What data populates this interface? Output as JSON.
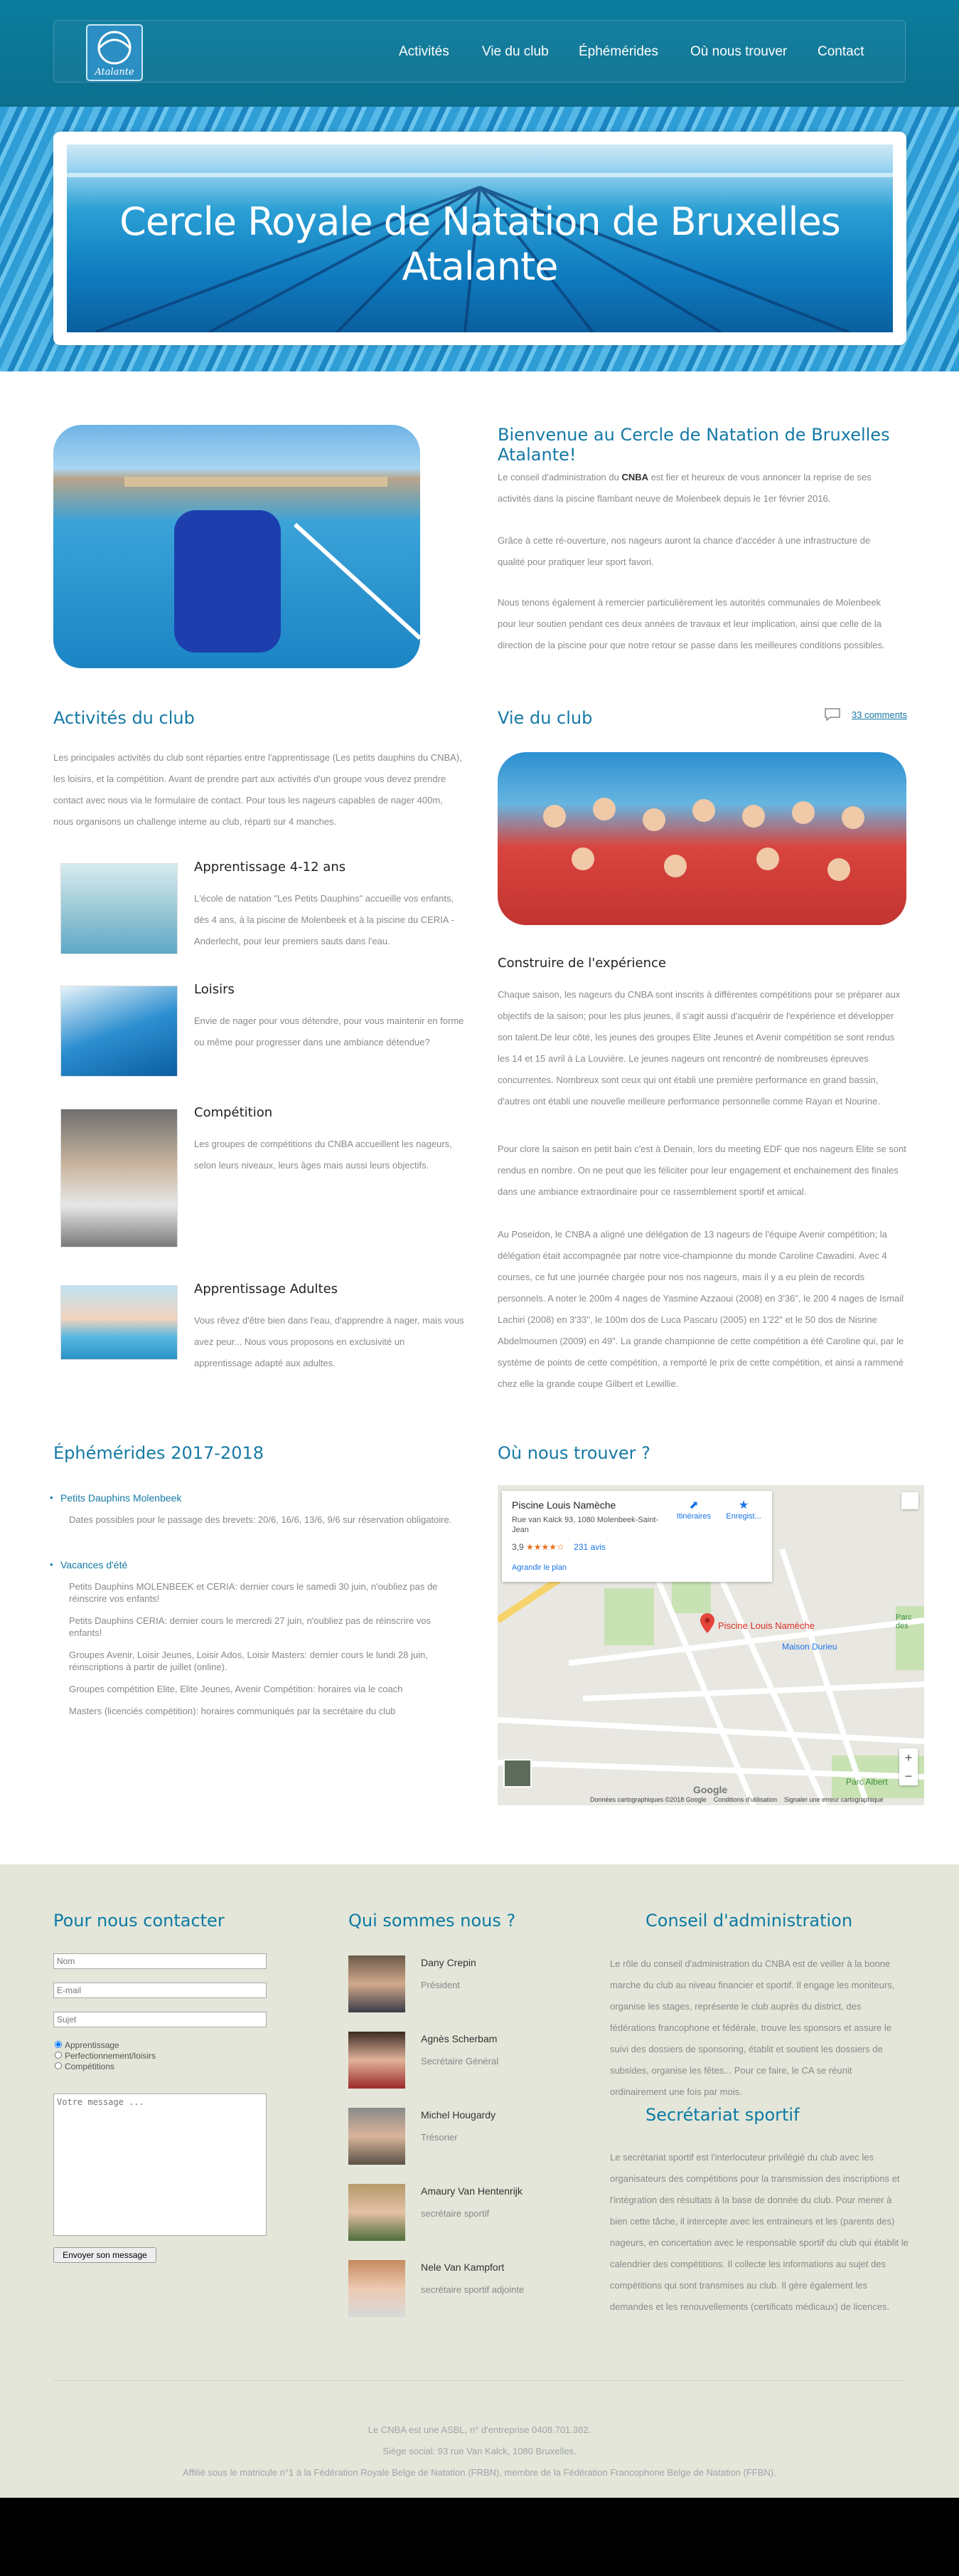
{
  "nav": {
    "logo_text": "Atalante",
    "items": [
      "Activités",
      "Vie du club",
      "Éphémérides",
      "Où nous trouver",
      "Contact"
    ]
  },
  "hero": {
    "title": "Cercle Royale de Natation de Bruxelles Atalante"
  },
  "welcome": {
    "title": "Bienvenue au Cercle de Natation de Bruxelles Atalante!",
    "p1_pre": "Le conseil d'administration du ",
    "p1_bold": "CNBA",
    "p1_post": " est fier et heureux de vous annoncer la reprise de ses activités dans la piscine flambant neuve de Molenbeek depuis le 1er février 2016.",
    "p2": "Grâce à cette ré-ouverture, nos nageurs auront la chance d'accéder à une infrastructure de qualité pour pratiquer leur sport favori.",
    "p3": "Nous tenons également à remercier particulièrement les autorités communales de Molenbeek pour leur soutien pendant ces deux années de travaux et leur implication, ainsi que celle de la direction de la piscine pour que notre retour se passe dans les meilleures conditions possibles."
  },
  "activities": {
    "title": "Activités du club",
    "intro": "Les principales activités du club sont réparties entre l'apprentissage (Les petits dauphins du CNBA), les loisirs, et la compétition. Avant de prendre part aux activités d'un groupe vous devez prendre contact avec nous via le formulaire de contact. Pour tous les nageurs capables de nager 400m, nous organisons un challenge interne au club, réparti sur 4 manches.",
    "items": [
      {
        "title": "Apprentissage 4-12 ans",
        "text": "L'école de natation \"Les Petits Dauphins\" accueille vos enfants, dès 4 ans, à la piscine de Molenbeek et à la piscine du CERIA - Anderlecht, pour leur premiers sauts dans l'eau."
      },
      {
        "title": "Loisirs",
        "text": "Envie de nager pour vous détendre, pour vous maintenir en forme ou même pour progresser dans une ambiance détendue?"
      },
      {
        "title": "Compétition",
        "text": "Les groupes de compétitions du CNBA accueillent les nageurs, selon leurs niveaux, leurs âges mais aussi leurs objectifs."
      },
      {
        "title": "Apprentissage Adultes",
        "text": "Vous rêvez d'être bien dans l'eau, d'apprendre à nager, mais vous avez peur... Nous vous proposons en exclusivité un apprentissage adapté aux adultes."
      }
    ]
  },
  "clublife": {
    "title": "Vie du club",
    "comments": "33 comments",
    "subtitle": "Construire de l'expérience",
    "p1": "Chaque saison, les nageurs du CNBA sont inscrits à différentes compétitions pour se préparer aux objectifs de la saison; pour les plus jeunes, il s'agit aussi d'acquérir de l'expérience et développer son talent.De leur côté, les jeunes des groupes Elite Jeunes et Avenir compétition se sont rendus les 14 et 15 avril à La Louvière. Le jeunes nageurs ont rencontré de nombreuses épreuves concurrentes. Nombreux sont ceux qui ont établi une première performance en grand bassin, d'autres ont établi une nouvelle meilleure performance personnelle comme Rayan et Nourine.",
    "p2": "Pour clore la saison en petit bain c'est à Denain, lors du meeting EDF que nos nageurs Elite se sont rendus en nombre. On ne peut que les féliciter pour leur engagement et enchainement des finales dans une ambiance extraordinaire pour ce rassemblement sportif et amical.",
    "p3": "Au Poseidon, le CNBA a aligné une délégation de 13 nageurs de l'équipe Avenir compétition; la délégation était accompagnée par notre vice-championne du monde Caroline Cawadini. Avec 4 courses, ce fut une journée chargée pour nos nos nageurs, mais il y a eu plein de records personnels. A noter le 200m 4 nages de Yasmine Azzaoui (2008) en 3'36\", le 200 4 nages de Ismail Lachiri (2008) en 3'33\", le 100m dos de Luca Pascaru (2005) en 1'22\" et le 50 dos de Nisrine Abdelmoumen (2009) en 49\". La grande championne de cette compétition a été Caroline qui, par le système de points de cette compétition, a remporté le prix de cette compétition, et ainsi a rammené chez elle la grande coupe Gilbert et Lewillie."
  },
  "ephemerides": {
    "title": "Éphémérides 2017-2018",
    "group1": "Petits Dauphins Molenbeek",
    "group1_items": [
      "Dates possibles pour le passage des brevets: 20/6, 16/6, 13/6, 9/6 sur réservation obligatoire."
    ],
    "group2": "Vacances d'été",
    "group2_items": [
      "Petits Dauphins MOLENBEEK et CERIA: dernier cours le samedi 30 juin, n'oubliez pas de réinscrire vos enfants!",
      "Petits Dauphins CERIA: dernier cours le mercredi 27 juin, n'oubliez pas de réinscrire vos enfants!",
      "Groupes Avenir, Loisir Jeunes, Loisir Ados, Loisir Masters: dernier cours le lundi 28 juin, réinscriptions à partir de juillet (online).",
      "Groupes compétition Elite, Elite Jeunes, Avenir Compétition: horaires via le coach",
      "Masters (licenciés compétition): horaires communiqués par la secrétaire du club"
    ]
  },
  "location": {
    "title": "Où nous trouver ?",
    "place": "Piscine Louis Namèche",
    "address": "Rue van Kalck 93, 1080 Molenbeek-Saint-Jean",
    "rating": "3,9",
    "stars": "★★★★☆",
    "reviews": "231 avis",
    "enlarge": "Agrandir le plan",
    "directions": "Itinéraires",
    "save": "Enregist...",
    "marker": "Piscine Louis Namèche",
    "poi": "Maison Durieu",
    "parc1": "Parc des",
    "parc2": "Parc Albert",
    "attribution": "Données cartographiques ©2018 Google    Conditions d'utilisation    Signaler une erreur cartographique",
    "google": "Google"
  },
  "contact": {
    "title": "Pour nous contacter",
    "name_ph": "Nom",
    "email_ph": "E-mail",
    "subject_ph": "Sujet",
    "radio": [
      "Apprentissage",
      "Perfectionnement/loisirs",
      "Compétitions"
    ],
    "message_ph": "Votre message ...",
    "submit": "Envoyer son message"
  },
  "about": {
    "title": "Qui sommes nous ?",
    "people": [
      {
        "name": "Dany Crepin",
        "role": "Président"
      },
      {
        "name": "Agnès Scherbam",
        "role": "Secrétaire Général"
      },
      {
        "name": "Michel Hougardy",
        "role": "Trésorier"
      },
      {
        "name": "Amaury Van Hentenrijk",
        "role": "secrétaire sportif"
      },
      {
        "name": "Nele Van Kampfort",
        "role": "secrétaire sportif adjointe"
      }
    ]
  },
  "board": {
    "title": "Conseil d'administration",
    "text": "Le rôle du conseil d'administration du CNBA est de veiller à la bonne marche du club au niveau financier et sportif. Il engage les moniteurs, organise les stages, représente le club auprès du district, des fédérations francophone et fédérale, trouve les sponsors et assure le suivi des dossiers de sponsoring, établit et soutient les dossiers de subsides, organise les fêtes... Pour ce faire, le CA se réunit ordinairement une fois par mois."
  },
  "sportsec": {
    "title": "Secrétariat sportif",
    "text": "Le secrétariat sportif est l'interlocuteur privilégié du club avec les organisateurs des compétitions pour la transmission des inscriptions et l'intégration des résultats à la base de donnée du club. Pour mener à bien cette tâche, il intercepte avec les entraineurs et les (parents des) nageurs, en concertation avec le responsable sportif du club qui établit le calendrier des compétitions. Il collecte les informations au sujet des compétitions qui sont transmises au club. Il gère également les demandes et les renouvellements (certificats médicaux) de licences."
  },
  "footer": {
    "line1": "Le CNBA est une ASBL, n° d'entreprise 0408.701.382.",
    "line2": "Siège social: 93 rue Van Kalck, 1080 Bruxelles.",
    "line3": "Affilié sous le matricule n°1 à la Fédération Royale Belge de Natation (FRBN), membre de la Fédération Francophone Belge de Natation (FFBN)."
  },
  "colors": {
    "accent": "#1679a5",
    "header": "#0b7d9e",
    "footer_bg": "#e3e6d9"
  }
}
